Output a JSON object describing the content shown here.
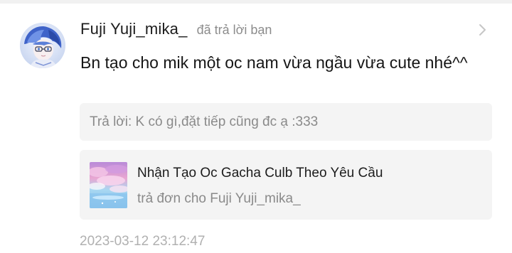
{
  "comment": {
    "username": "Fuji Yuji_mika_",
    "action_text": "đã trả lời bạn",
    "message": "Bn tạo cho mik một oc nam vừa ngầu vừa cute nhé^^",
    "quoted_reply": "Trả lời: K có gì,đặt tiếp cũng đc ạ :333",
    "timestamp": "2023-03-12 23:12:47"
  },
  "linked_post": {
    "title": "Nhận Tạo Oc Gacha Culb Theo Yêu Cầu",
    "subtitle": "trả đơn cho Fuji Yuji_mika_"
  },
  "icons": {
    "avatar": "user-avatar",
    "chevron": "chevron-right-icon",
    "thumbnail": "story-cover-thumbnail"
  },
  "colors": {
    "text_primary": "#1c1c1c",
    "text_secondary": "#8a8a8a",
    "timestamp": "#b0b0b0",
    "panel_bg": "#f4f4f4"
  }
}
